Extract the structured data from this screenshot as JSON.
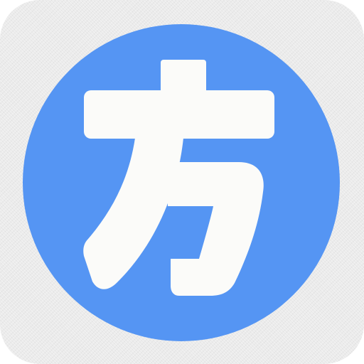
{
  "icon": {
    "character": "方",
    "circle_color": "#5595f3",
    "glyph_color": "#fbfbf9",
    "background_color": "#ebebeb"
  }
}
